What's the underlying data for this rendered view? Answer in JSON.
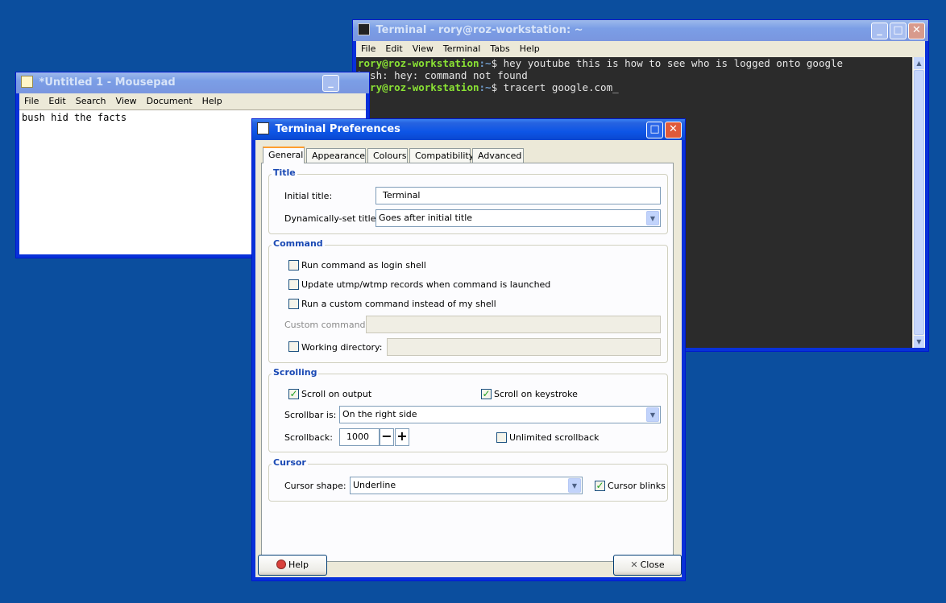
{
  "terminal_window": {
    "title": "Terminal - rory@roz-workstation: ~",
    "menu": [
      "File",
      "Edit",
      "View",
      "Terminal",
      "Tabs",
      "Help"
    ],
    "lines": [
      {
        "user": "rory@roz-workstation",
        "path": ":~",
        "text": "$ hey youtube this is how to see who is logged onto google"
      },
      {
        "user": "",
        "path": "",
        "text": "bash: hey: command not found"
      },
      {
        "user": "rory@roz-workstation",
        "path": ":~",
        "text": "$ tracert google.com_"
      }
    ]
  },
  "mousepad_window": {
    "title": "*Untitled 1 - Mousepad",
    "menu": [
      "File",
      "Edit",
      "Search",
      "View",
      "Document",
      "Help"
    ],
    "content": "bush hid the facts"
  },
  "prefs_dialog": {
    "title": "Terminal Preferences",
    "tabs": [
      "General",
      "Appearance",
      "Colours",
      "Compatibility",
      "Advanced"
    ],
    "title_group": {
      "heading": "Title",
      "initial_title_label": "Initial title:",
      "initial_title_value": "Terminal",
      "dynamic_title_label": "Dynamically-set title:",
      "dynamic_title_value": "Goes after initial title"
    },
    "command_group": {
      "heading": "Command",
      "login_shell": "Run command as login shell",
      "update_utmp": "Update utmp/wtmp records when command is launched",
      "custom_command_toggle": "Run a custom command instead of my shell",
      "custom_command_label": "Custom command:",
      "working_dir_label": "Working directory:"
    },
    "scrolling_group": {
      "heading": "Scrolling",
      "scroll_output": "Scroll on output",
      "scroll_keystroke": "Scroll on keystroke",
      "scrollbar_label": "Scrollbar is:",
      "scrollbar_value": "On the right side",
      "scrollback_label": "Scrollback:",
      "scrollback_value": "1000",
      "minus": "−",
      "plus": "+",
      "unlimited": "Unlimited scrollback"
    },
    "cursor_group": {
      "heading": "Cursor",
      "shape_label": "Cursor shape:",
      "shape_value": "Underline",
      "blinks": "Cursor blinks"
    },
    "help_button": "Help",
    "close_button": "Close"
  },
  "titlebar_buttons": {
    "minimize": "_",
    "maximize": "□",
    "close": "✕"
  },
  "checkmark": "✓",
  "dropdown_arrow": "▼",
  "colors": {
    "desktop": "#0B4E9E",
    "titlebar_active": "#0A47CF",
    "group_heading": "#1A49B4",
    "prompt_user": "#8AE234",
    "prompt_path": "#729FCF",
    "terminal_bg": "#2B2B2B"
  }
}
